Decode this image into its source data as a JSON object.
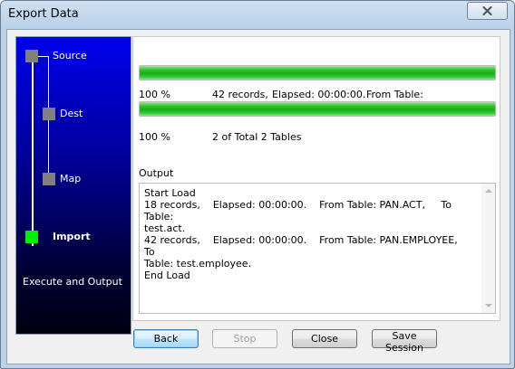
{
  "window": {
    "title": "Export Data"
  },
  "steps": [
    {
      "label": "Source",
      "active": false
    },
    {
      "label": "Dest",
      "active": false
    },
    {
      "label": "Map",
      "active": false
    },
    {
      "label": "Import",
      "active": true
    },
    {
      "label": "Execute and Output",
      "active": false
    }
  ],
  "progress_records": {
    "percent_text": "100 %",
    "value": 1.0,
    "records_text": "42 records,",
    "elapsed_text": "Elapsed: 00:00:00.",
    "from_table_text": "From Table:"
  },
  "progress_tables": {
    "percent_text": "100 %",
    "value": 1.0,
    "tables_text": "2 of Total 2 Tables"
  },
  "output": {
    "label": "Output",
    "text": "Start Load\n18 records,    Elapsed: 00:00:00.    From Table: PAN.ACT,     To Table:\ntest.act.\n42 records,    Elapsed: 00:00:00.    From Table: PAN.EMPLOYEE,     To\nTable: test.employee.\nEnd Load"
  },
  "buttons": {
    "back": "Back",
    "stop": "Stop",
    "close": "Close",
    "save_session": "Save Session"
  },
  "colors": {
    "progress_green": "#14b014",
    "active_step": "#00ee00",
    "inactive_step": "#808080",
    "steps_panel_top": "#0000ee"
  }
}
